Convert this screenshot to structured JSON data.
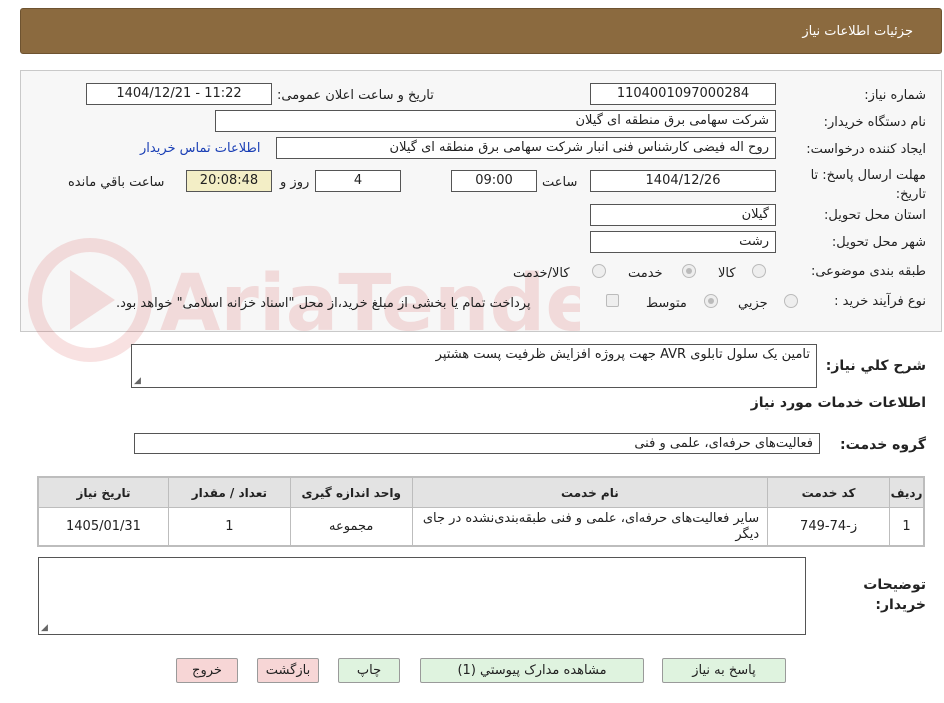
{
  "header": {
    "title": "جزئیات اطلاعات نیاز"
  },
  "form": {
    "need_number_label": "شماره نیاز:",
    "need_number": "1104001097000284",
    "announce_label": "تاریخ و ساعت اعلان عمومی:",
    "announce_value": "1404/12/21 - 11:22",
    "buyer_label": "نام دستگاه خریدار:",
    "buyer": "شرکت سهامی برق منطقه ای گیلان",
    "creator_label": "ایجاد کننده درخواست:",
    "creator": "روح اله فیضی کارشناس فنی انبار شرکت سهامی برق منطقه ای گیلان",
    "contact_link": "اطلاعات تماس خریدار",
    "deadline_label": "مهلت ارسال پاسخ: تا تاریخ:",
    "deadline_date": "1404/12/26",
    "time_label": "ساعت",
    "deadline_time": "09:00",
    "days_value": "4",
    "days_label": "روز و",
    "remaining_time": "20:08:48",
    "remaining_label": "ساعت باقي مانده",
    "province_label": "استان محل تحویل:",
    "province": "گیلان",
    "city_label": "شهر محل تحویل:",
    "city": "رشت",
    "category_label": "طبقه بندی موضوعی:",
    "category_options": [
      "کالا",
      "خدمت",
      "کالا/خدمت"
    ],
    "category_selected": "خدمت",
    "process_label": "نوع فرآیند خرید :",
    "process_options": [
      "جزيي",
      "متوسط"
    ],
    "process_selected": "متوسط",
    "payment_note": "پرداخت تمام یا بخشی از مبلغ خرید،از محل \"اسناد خزانه اسلامی\" خواهد بود."
  },
  "summary": {
    "label": "شرح کلي نیاز:",
    "text": "تامین یک سلول تابلوی AVR  جهت پروژه افزایش ظرفیت پست هشتپر"
  },
  "services": {
    "section_title": "اطلاعات خدمات مورد نیاز",
    "group_label": "گروه خدمت:",
    "group_value": "فعالیت‌های حرفه‌ای، علمی و فنی",
    "columns": [
      "ردیف",
      "کد خدمت",
      "نام خدمت",
      "واحد اندازه گیری",
      "تعداد / مقدار",
      "تاریخ نیاز"
    ],
    "rows": [
      {
        "row": "1",
        "code": "ز-74-749",
        "name": "سایر فعالیت‌های حرفه‌ای، علمی و فنی طبقه‌بندی‌نشده در جای دیگر",
        "unit": "مجموعه",
        "qty": "1",
        "date": "1405/01/31"
      }
    ]
  },
  "notes": {
    "label": "توضیحات خریدار:",
    "text": ""
  },
  "buttons": {
    "reply": "پاسخ به نیاز",
    "attachments": "مشاهده مدارک پیوستي (1)",
    "print": "چاپ",
    "back": "بازگشت",
    "exit": "خروج"
  },
  "colors": {
    "header": "#8b6a3f",
    "button_green": "#dff3df",
    "button_pink": "#f7d6d6",
    "link": "#1a3fb5",
    "highlight": "#f3eec6"
  },
  "watermark": {
    "text": "AriaTender.neT"
  }
}
